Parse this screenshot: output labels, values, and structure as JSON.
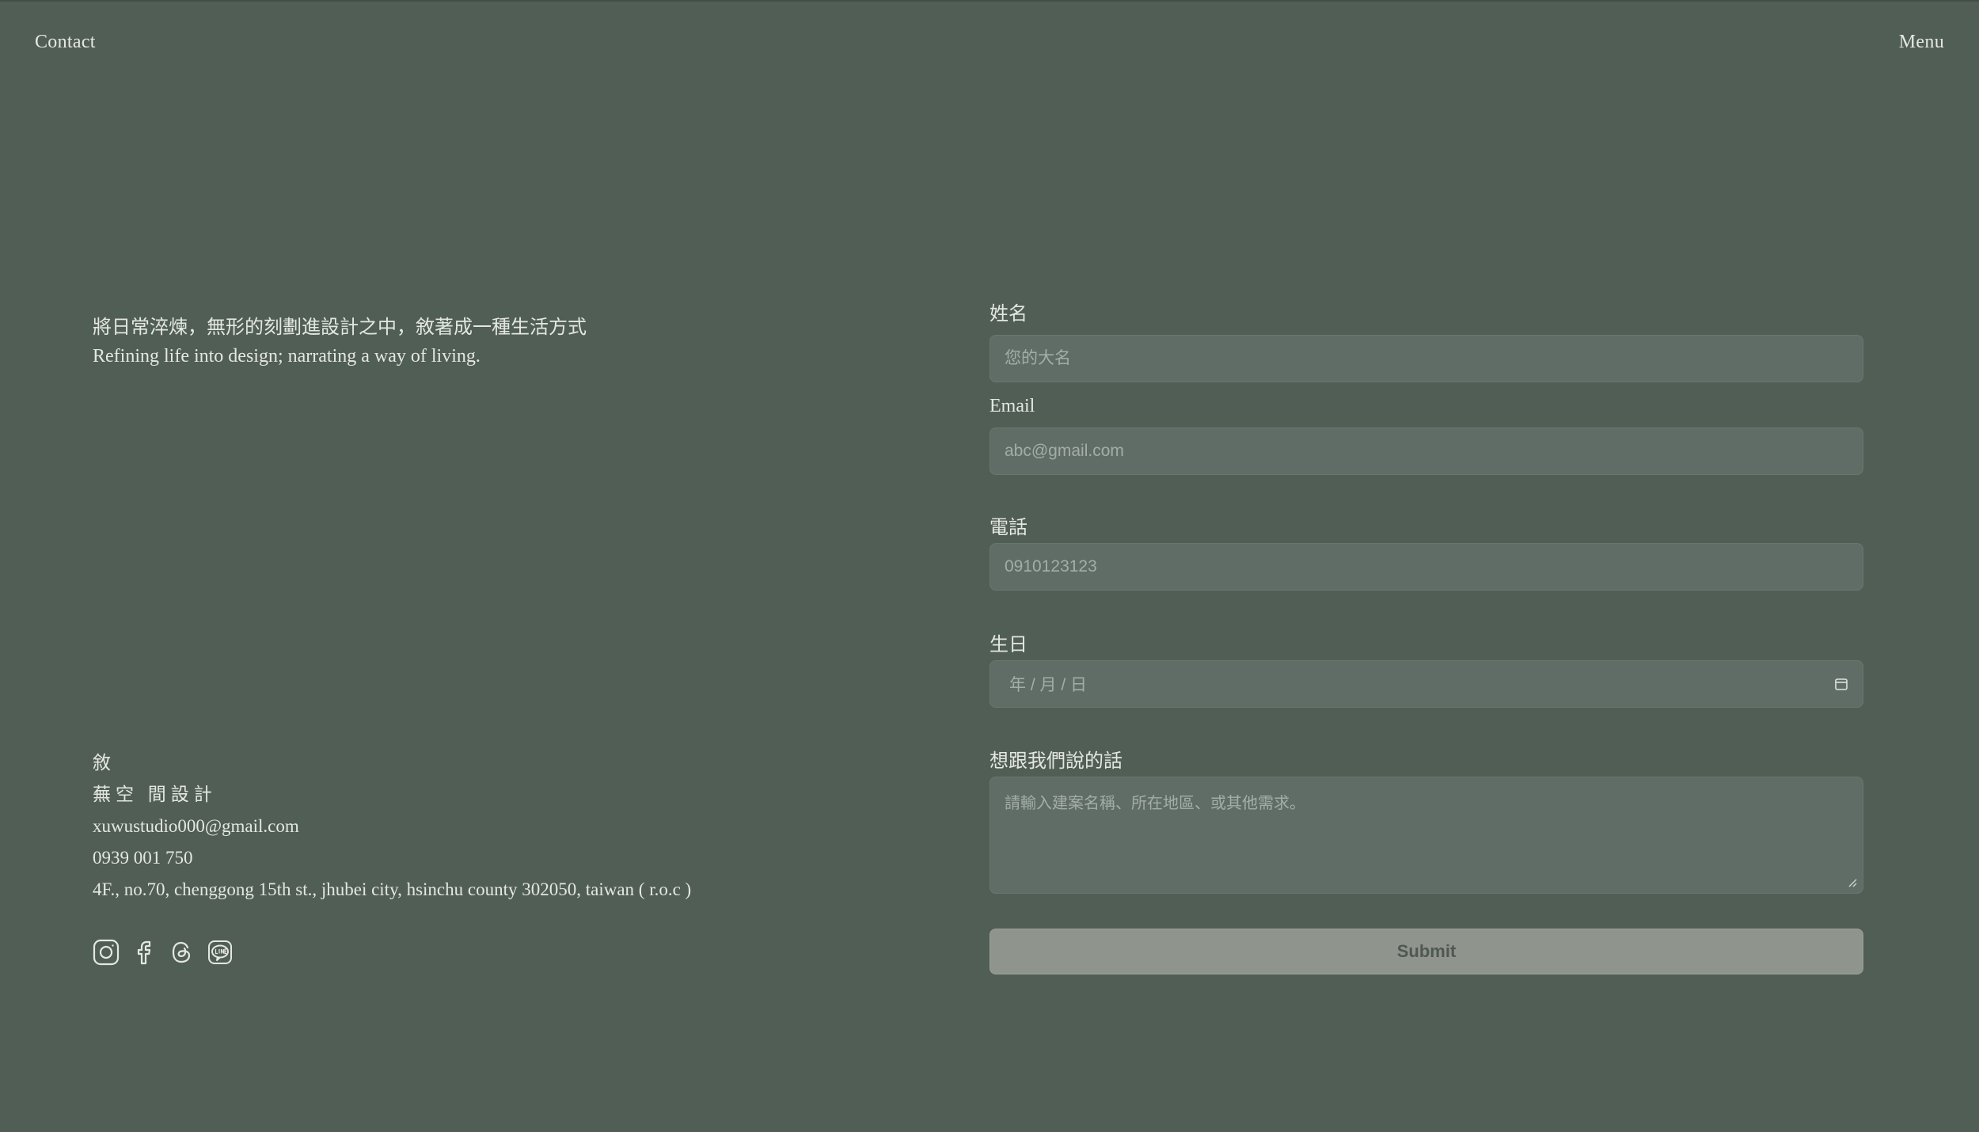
{
  "nav": {
    "left_label": "Contact",
    "right_label": "Menu"
  },
  "tagline": {
    "zh": "將日常淬煉，無形的刻劃進設計之中，敘著成一種生活方式",
    "en": "Refining life into design; narrating a way of living."
  },
  "studio": {
    "name_line1": "敘",
    "name_line2": "蕪空  間設計",
    "email": "xuwustudio000@gmail.com",
    "phone": "0939 001 750",
    "address": "4F., no.70, chenggong 15th st., jhubei city, hsinchu county 302050, taiwan ( r.o.c )"
  },
  "social": {
    "icons": [
      "instagram-icon",
      "facebook-icon",
      "threads-icon",
      "line-icon"
    ]
  },
  "form": {
    "name": {
      "label": "姓名",
      "placeholder": "您的大名",
      "value": ""
    },
    "email": {
      "label": "Email",
      "placeholder": "abc@gmail.com",
      "value": ""
    },
    "phone": {
      "label": "電話",
      "placeholder": "0910123123",
      "value": ""
    },
    "birthday": {
      "label": "生日",
      "placeholder": "年 / 月 / 日"
    },
    "message": {
      "label": "想跟我們說的話",
      "placeholder": "請輸入建案名稱、所在地區、或其他需求。",
      "value": ""
    },
    "submit_label": "Submit"
  },
  "colors": {
    "background": "#515e56",
    "field_bg": "#606d66",
    "submit_bg": "#8f948d",
    "text": "#e4e7e1"
  }
}
